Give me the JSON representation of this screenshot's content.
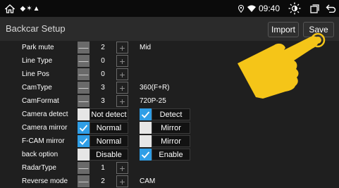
{
  "status_bar": {
    "home_icon": "home-icon",
    "notification_icons": "◆✶▲",
    "time": "09:40"
  },
  "header": {
    "title": "Backcar Setup",
    "import_label": "Import",
    "save_label": "Save"
  },
  "rows": [
    {
      "label": "Park mute",
      "value": "2",
      "extra": "Mid"
    },
    {
      "label": "Line Type",
      "value": "0"
    },
    {
      "label": "Line Pos",
      "value": "0"
    },
    {
      "label": "CamType",
      "value": "3",
      "extra": "360(F+R)"
    },
    {
      "label": "CamFormat",
      "value": "3",
      "extra": "720P-25"
    },
    {
      "label": "Camera detect",
      "option_a": "Not detect",
      "option_b": "Detect",
      "selected": "b"
    },
    {
      "label": "Camera mirror",
      "option_a": "Normal",
      "option_b": "Mirror",
      "selected": "a"
    },
    {
      "label": "F-CAM mirror",
      "option_a": "Normal",
      "option_b": "Mirror",
      "selected": "a"
    },
    {
      "label": "back option",
      "option_a": "Disable",
      "option_b": "Enable",
      "selected": "b"
    },
    {
      "label": "RadarType",
      "value": "1"
    },
    {
      "label": "Reverse mode",
      "value": "2",
      "extra": "CAM"
    }
  ],
  "stepper": {
    "minus": "—",
    "plus": "+"
  },
  "colors": {
    "accent": "#2f9ee6",
    "hand": "#f5c518"
  }
}
